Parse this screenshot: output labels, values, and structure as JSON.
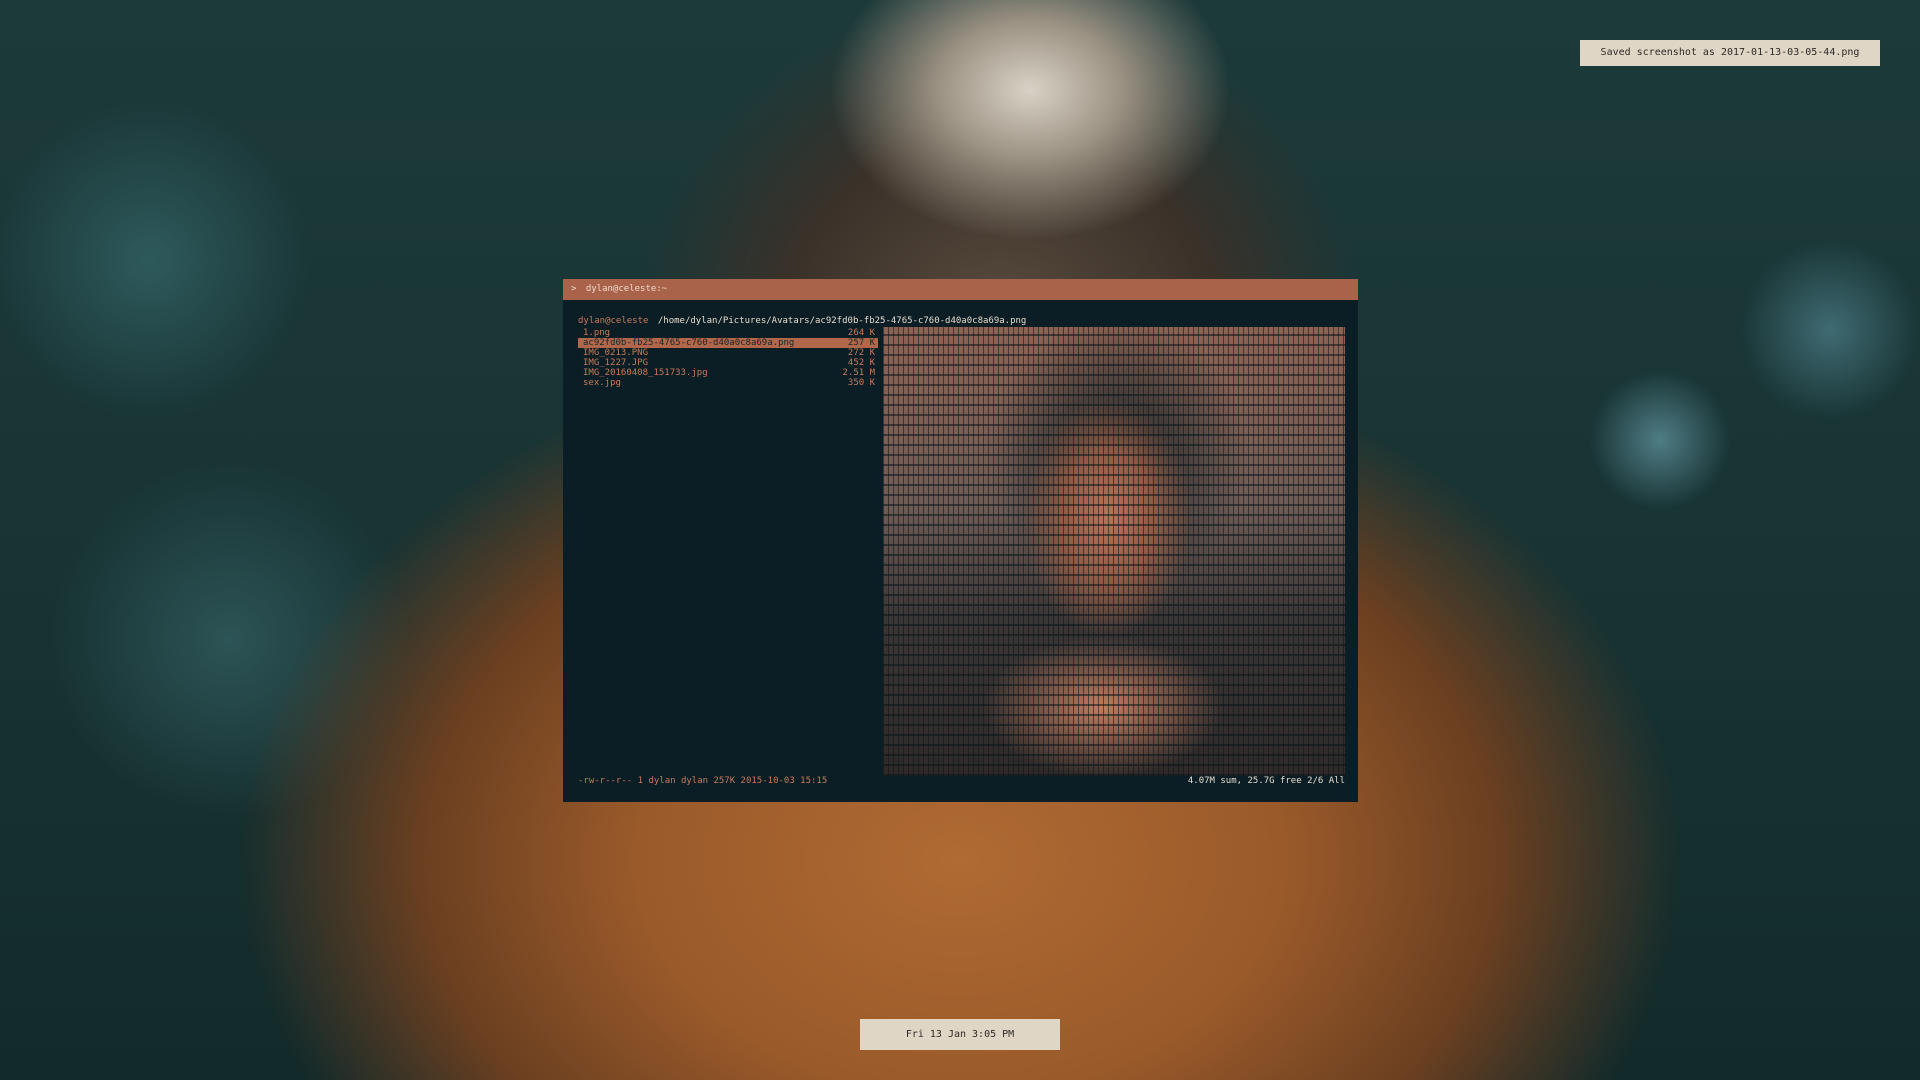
{
  "notification": {
    "text": "Saved screenshot as 2017-01-13-03-05-44.png"
  },
  "clock": {
    "text": "Fri 13 Jan  3:05 PM"
  },
  "terminal": {
    "title_prompt": ">",
    "title": "dylan@celeste:~",
    "host": "dylan@celeste",
    "path": "/home/dylan/Pictures/Avatars/ac92fd0b-fb25-4765-c760-d40a0c8a69a.png",
    "files": [
      {
        "name": "1.png",
        "size": "264 K"
      },
      {
        "name": "ac92fd0b-fb25-4765-c760-d40a0c8a69a.png",
        "size": "257 K"
      },
      {
        "name": "IMG_0213.PNG",
        "size": "272 K"
      },
      {
        "name": "IMG_1227.JPG",
        "size": "452 K"
      },
      {
        "name": "IMG_20160408_151733.jpg",
        "size": "2.51 M"
      },
      {
        "name": "sex.jpg",
        "size": "350 K"
      }
    ],
    "selected_index": 1,
    "status_left": "-rw-r--r-- 1 dylan dylan 257K 2015-10-03 15:15",
    "status_right": "4.07M sum, 25.7G free  2/6  All"
  },
  "colors": {
    "accent": "#a8634a",
    "terminal_bg": "#0b1e25",
    "text": "#c97a5a",
    "bar_bg": "#e0d6c5"
  }
}
